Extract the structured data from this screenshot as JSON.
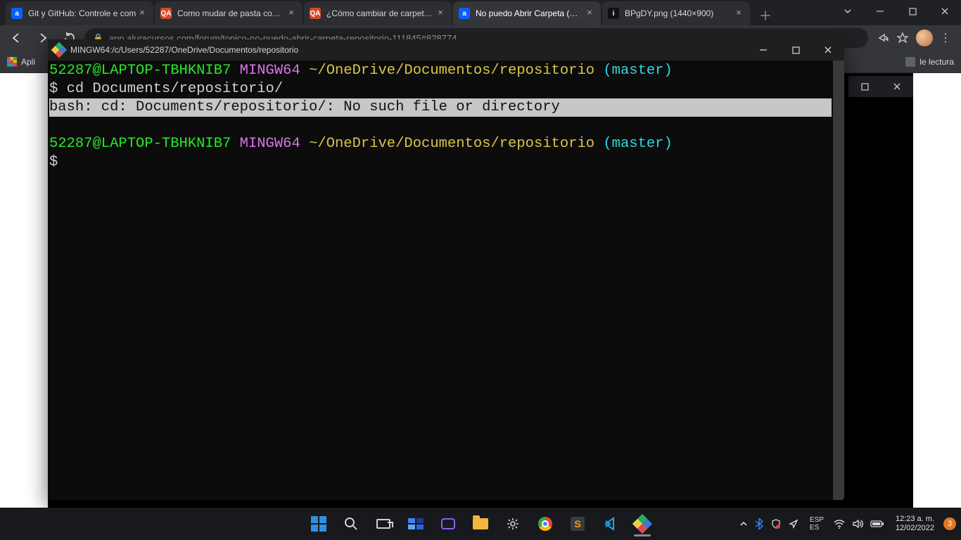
{
  "chrome": {
    "tabs": [
      {
        "title": "Git y GitHub: Controle e com",
        "favicon": "a"
      },
      {
        "title": "Como mudar de pasta com c",
        "favicon": "qa"
      },
      {
        "title": "¿Cómo cambiar de carpeta c",
        "favicon": "qa"
      },
      {
        "title": "No puedo Abrir Carpeta (REF",
        "favicon": "a",
        "active": true
      },
      {
        "title": "BPgDY.png (1440×900)",
        "favicon": "i"
      }
    ],
    "url": "app.aluracursos.com/forum/topico-no-puedo-abrir-carpeta-repositorio-111845#828774",
    "bookmarks": {
      "apps_label": "Apli",
      "reading_list": "le lectura"
    }
  },
  "terminal": {
    "window_title": "MINGW64:/c/Users/52287/OneDrive/Documentos/repositorio",
    "prompt1": {
      "user": "52287@LAPTOP-TBHKNIB7",
      "env": "MINGW64",
      "path": "~/OneDrive/Documentos/repositorio",
      "branch": "(master)"
    },
    "cmd1_prefix": "$ ",
    "cmd1": "cd Documents/repositorio/",
    "error": "bash: cd: Documents/repositorio/: No such file or directory",
    "prompt2": {
      "user": "52287@LAPTOP-TBHKNIB7",
      "env": "MINGW64",
      "path": "~/OneDrive/Documentos/repositorio",
      "branch": "(master)"
    },
    "cmd2_prefix": "$"
  },
  "taskbar": {
    "lang_top": "ESP",
    "lang_bottom": "ES",
    "time": "12:23 a. m.",
    "date": "12/02/2022",
    "notif_count": "3"
  }
}
